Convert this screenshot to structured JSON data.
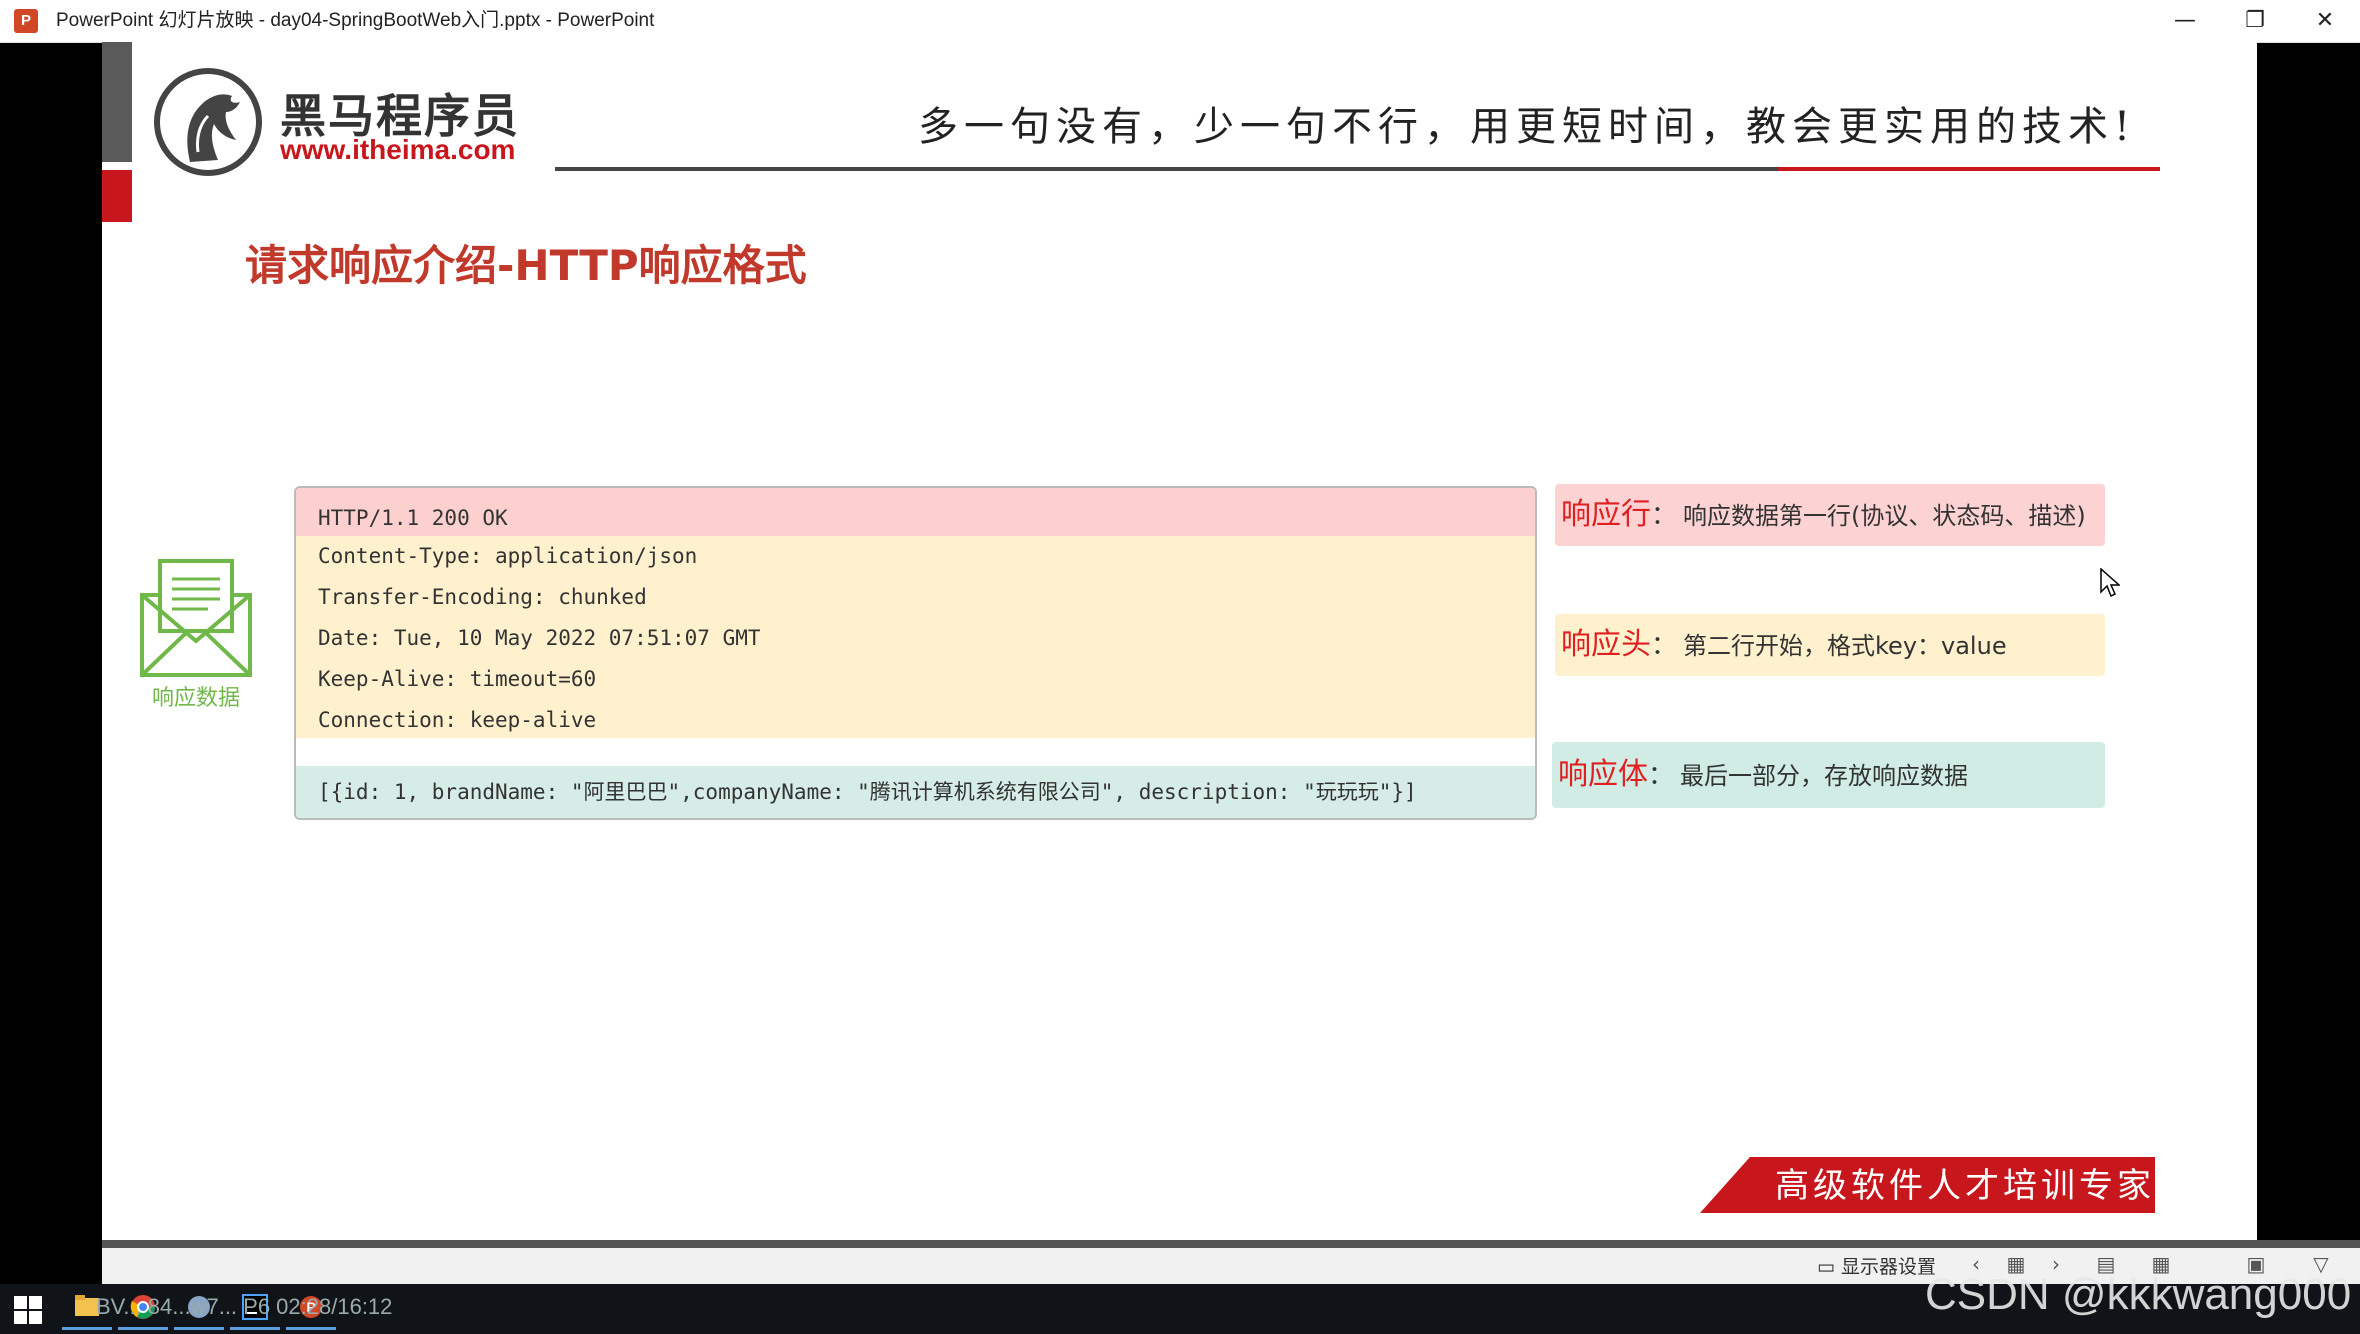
{
  "window": {
    "app_icon": "P",
    "title": "PowerPoint 幻灯片放映  -  day04-SpringBootWeb入门.pptx - PowerPoint",
    "minimize": "—",
    "restore": "❐",
    "close": "✕"
  },
  "slide": {
    "logo_name": "黑马程序员",
    "logo_url": "www.itheima.com",
    "slogan": "多一句没有，少一句不行，用更短时间，教会更实用的技术!",
    "title": "请求响应介绍-HTTP响应格式",
    "envelope_label": "响应数据",
    "http": {
      "status_line": "HTTP/1.1 200 OK",
      "headers": [
        "Content-Type: application/json",
        "Transfer-Encoding: chunked",
        "Date: Tue, 10 May 2022 07:51:07 GMT",
        "Keep-Alive: timeout=60",
        "Connection: keep-alive"
      ],
      "body": "[{id: 1, brandName: \"阿里巴巴\",companyName: \"腾讯计算机系统有限公司\", description: \"玩玩玩\"}]"
    },
    "annotations": {
      "line_label": "响应行",
      "line_desc": "响应数据第一行(协议、状态码、描述)",
      "head_label": "响应头",
      "head_desc": "第二行开始，格式key：value",
      "body_label": "响应体",
      "body_desc": "最后一部分，存放响应数据",
      "colon": "："
    },
    "brand_banner": "高级软件人才培训专家"
  },
  "statusbar": {
    "monitor_label": "显示器设置"
  },
  "taskbar": {
    "overlay_text": "BV... 84...w7... P6 02:28/16:12"
  },
  "watermark": "CSDN @kkkwang000",
  "colors": {
    "accent_red": "#c8161d",
    "title_red": "#c0392b",
    "status_row": "#fdd0d0",
    "header_rows": "#fff1cd",
    "body_row": "#d6ede7",
    "envelope_green": "#71b84a"
  }
}
